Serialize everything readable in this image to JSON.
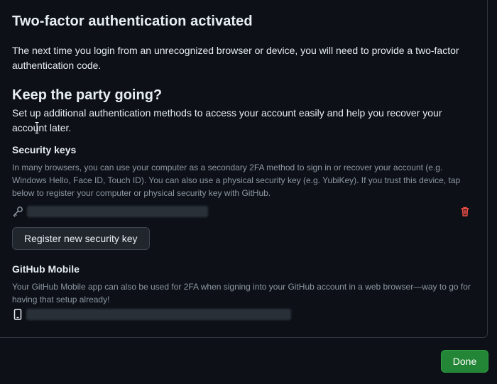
{
  "title": "Two-factor authentication activated",
  "intro": "The next time you login from an unrecognized browser or device, you will need to provide a two-factor authentication code.",
  "subtitle": "Keep the party going?",
  "subtext": "Set up additional authentication methods to access your account easily and help you recover your account later.",
  "security_keys": {
    "heading": "Security keys",
    "description": "In many browsers, you can use your computer as a secondary 2FA method to sign in or recover your account (e.g. Windows Hello, Face ID, Touch ID). You can also use a physical security key (e.g. YubiKey). If you trust this device, tap below to register your computer or physical security key with GitHub.",
    "key_icon": "key-icon",
    "delete_icon": "trash-icon",
    "register_button": "Register new security key"
  },
  "github_mobile": {
    "heading": "GitHub Mobile",
    "description": "Your GitHub Mobile app can also be used for 2FA when signing into your GitHub account in a web browser—way to go for having that setup already!",
    "device_icon": "mobile-device-icon"
  },
  "done_button": "Done",
  "colors": {
    "background": "#0d1117",
    "border": "#30363d",
    "muted_text": "#8d96a0",
    "danger": "#f85149",
    "success_button": "#238636"
  }
}
